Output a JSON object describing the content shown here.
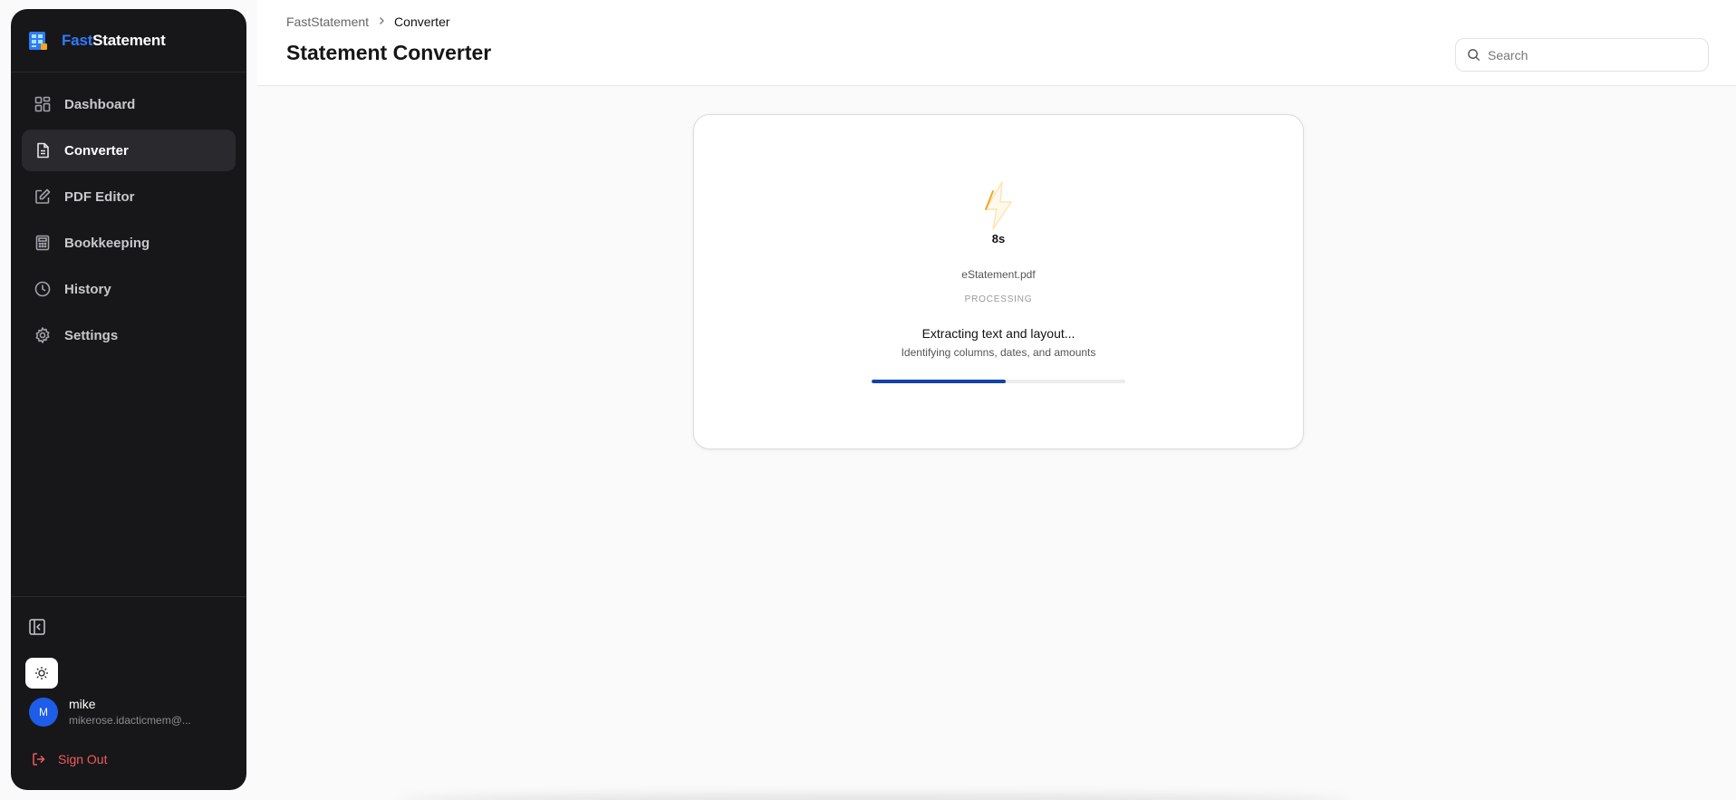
{
  "brand": {
    "part1": "Fast",
    "part2": "Statement"
  },
  "sidebar": {
    "items": [
      {
        "label": "Dashboard",
        "icon": "dashboard-icon",
        "active": false
      },
      {
        "label": "Converter",
        "icon": "document-icon",
        "active": true
      },
      {
        "label": "PDF Editor",
        "icon": "edit-icon",
        "active": false
      },
      {
        "label": "Bookkeeping",
        "icon": "calculator-icon",
        "active": false
      },
      {
        "label": "History",
        "icon": "clock-icon",
        "active": false
      },
      {
        "label": "Settings",
        "icon": "gear-icon",
        "active": false
      }
    ],
    "user": {
      "initial": "M",
      "name": "mike",
      "email": "mikerose.idacticmem@..."
    },
    "sign_out": "Sign Out"
  },
  "header": {
    "breadcrumb": {
      "root": "FastStatement",
      "current": "Converter"
    },
    "title": "Statement Converter",
    "search_placeholder": "Search"
  },
  "card": {
    "timer": "8s",
    "file_name": "eStatement.pdf",
    "status": "PROCESSING",
    "step_title": "Extracting text and layout...",
    "step_subtitle": "Identifying columns, dates, and amounts",
    "progress": 0.53
  },
  "colors": {
    "accent": "#2f7bf6",
    "progress": "#1442a8",
    "sidebar_bg": "#17171a",
    "danger": "#f15a5a",
    "bolt": "#f5a623"
  }
}
